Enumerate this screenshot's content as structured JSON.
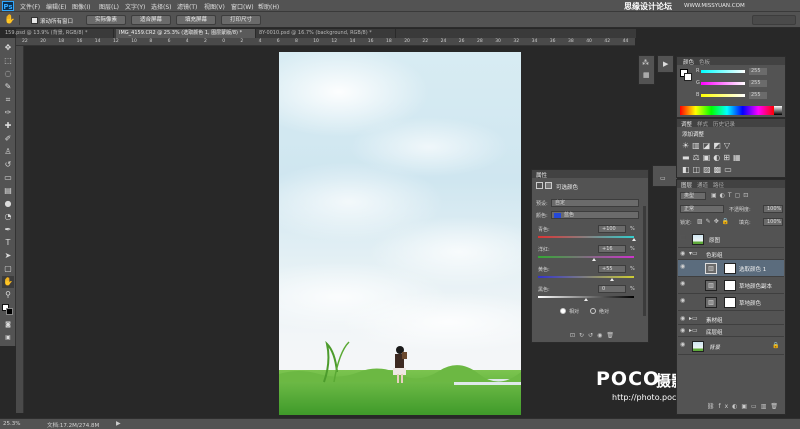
{
  "menubar": {
    "logo": "Ps",
    "items": [
      "文件(F)",
      "编辑(E)",
      "图像(I)",
      "图层(L)",
      "文字(Y)",
      "选择(S)",
      "滤镜(T)",
      "视图(V)",
      "窗口(W)",
      "帮助(H)"
    ],
    "site_watermark": "思缘设计论坛",
    "site_url": "WWW.MISSYUAN.COM"
  },
  "options_bar": {
    "checkbox_label": "滚动所有窗口",
    "buttons": [
      "实际像素",
      "适合屏幕",
      "填充屏幕",
      "打印尺寸"
    ]
  },
  "doc_tabs": [
    {
      "label": "159.psd @ 13.9% (背景, RGB/8) *"
    },
    {
      "label": "IMG_4159.CR2 @ 25.3% (选取颜色 1, 图层蒙版/8) *"
    },
    {
      "label": "8Y-0010.psd @ 16.7% (background, RGB/8) *"
    }
  ],
  "ruler_ticks": [
    "22",
    "20",
    "18",
    "16",
    "14",
    "12",
    "10",
    "8",
    "6",
    "4",
    "2",
    "0",
    "2",
    "4",
    "6",
    "8",
    "10",
    "12",
    "14",
    "16",
    "18",
    "20",
    "22",
    "24",
    "26",
    "28",
    "30",
    "32",
    "34",
    "36",
    "38",
    "40",
    "42",
    "44"
  ],
  "status": {
    "zoom": "25.3%",
    "doc_info": "文档:17.2M/274.8M"
  },
  "color_panel": {
    "tab1": "颜色",
    "tab2": "色板",
    "channels": [
      {
        "label": "R",
        "value": "255"
      },
      {
        "label": "G",
        "value": "255"
      },
      {
        "label": "B",
        "value": "255"
      }
    ]
  },
  "adjust_panel": {
    "tabs": [
      "调整",
      "样式",
      "历史记录"
    ],
    "title": "添加调整"
  },
  "properties_panel": {
    "header": "属性",
    "title": "可选颜色",
    "preset_label": "预设:",
    "preset_value": "自定",
    "color_label": "颜色:",
    "color_value": "蓝色",
    "rows": [
      {
        "label": "青色:",
        "value": "+100",
        "unit": "%",
        "pos": 1.0
      },
      {
        "label": "洋红:",
        "value": "+16",
        "unit": "%",
        "pos": 0.58
      },
      {
        "label": "黄色:",
        "value": "+55",
        "unit": "%",
        "pos": 0.775
      },
      {
        "label": "黑色:",
        "value": "0",
        "unit": "%",
        "pos": 0.5
      }
    ],
    "radio_relative": "相对",
    "radio_absolute": "绝对"
  },
  "layers_panel": {
    "tabs": [
      "图层",
      "通道",
      "路径"
    ],
    "kind_label": "类型",
    "blend_mode": "正常",
    "opacity_label": "不透明度:",
    "opacity": "100%",
    "lock_label": "锁定:",
    "fill_label": "填充:",
    "fill": "100%",
    "layers": [
      {
        "name": "原图",
        "type": "layer"
      },
      {
        "name": "色彩组",
        "type": "group"
      },
      {
        "name": "选取颜色 1",
        "type": "adjustment"
      },
      {
        "name": "草地颜色副本",
        "type": "adjustment"
      },
      {
        "name": "草地颜色",
        "type": "adjustment"
      },
      {
        "name": "素材组",
        "type": "group"
      },
      {
        "name": "底层组",
        "type": "group"
      },
      {
        "name": "背景",
        "type": "background"
      }
    ]
  },
  "poco_watermark": {
    "brand": "POCO",
    "subtitle": "摄影专题",
    "url": "http://photo.poco.cn/"
  },
  "colors": {
    "accent": "#31a8ff",
    "panel_bg": "#535353",
    "canvas_bg": "#282828",
    "selected_row": "#5b6c7d"
  }
}
